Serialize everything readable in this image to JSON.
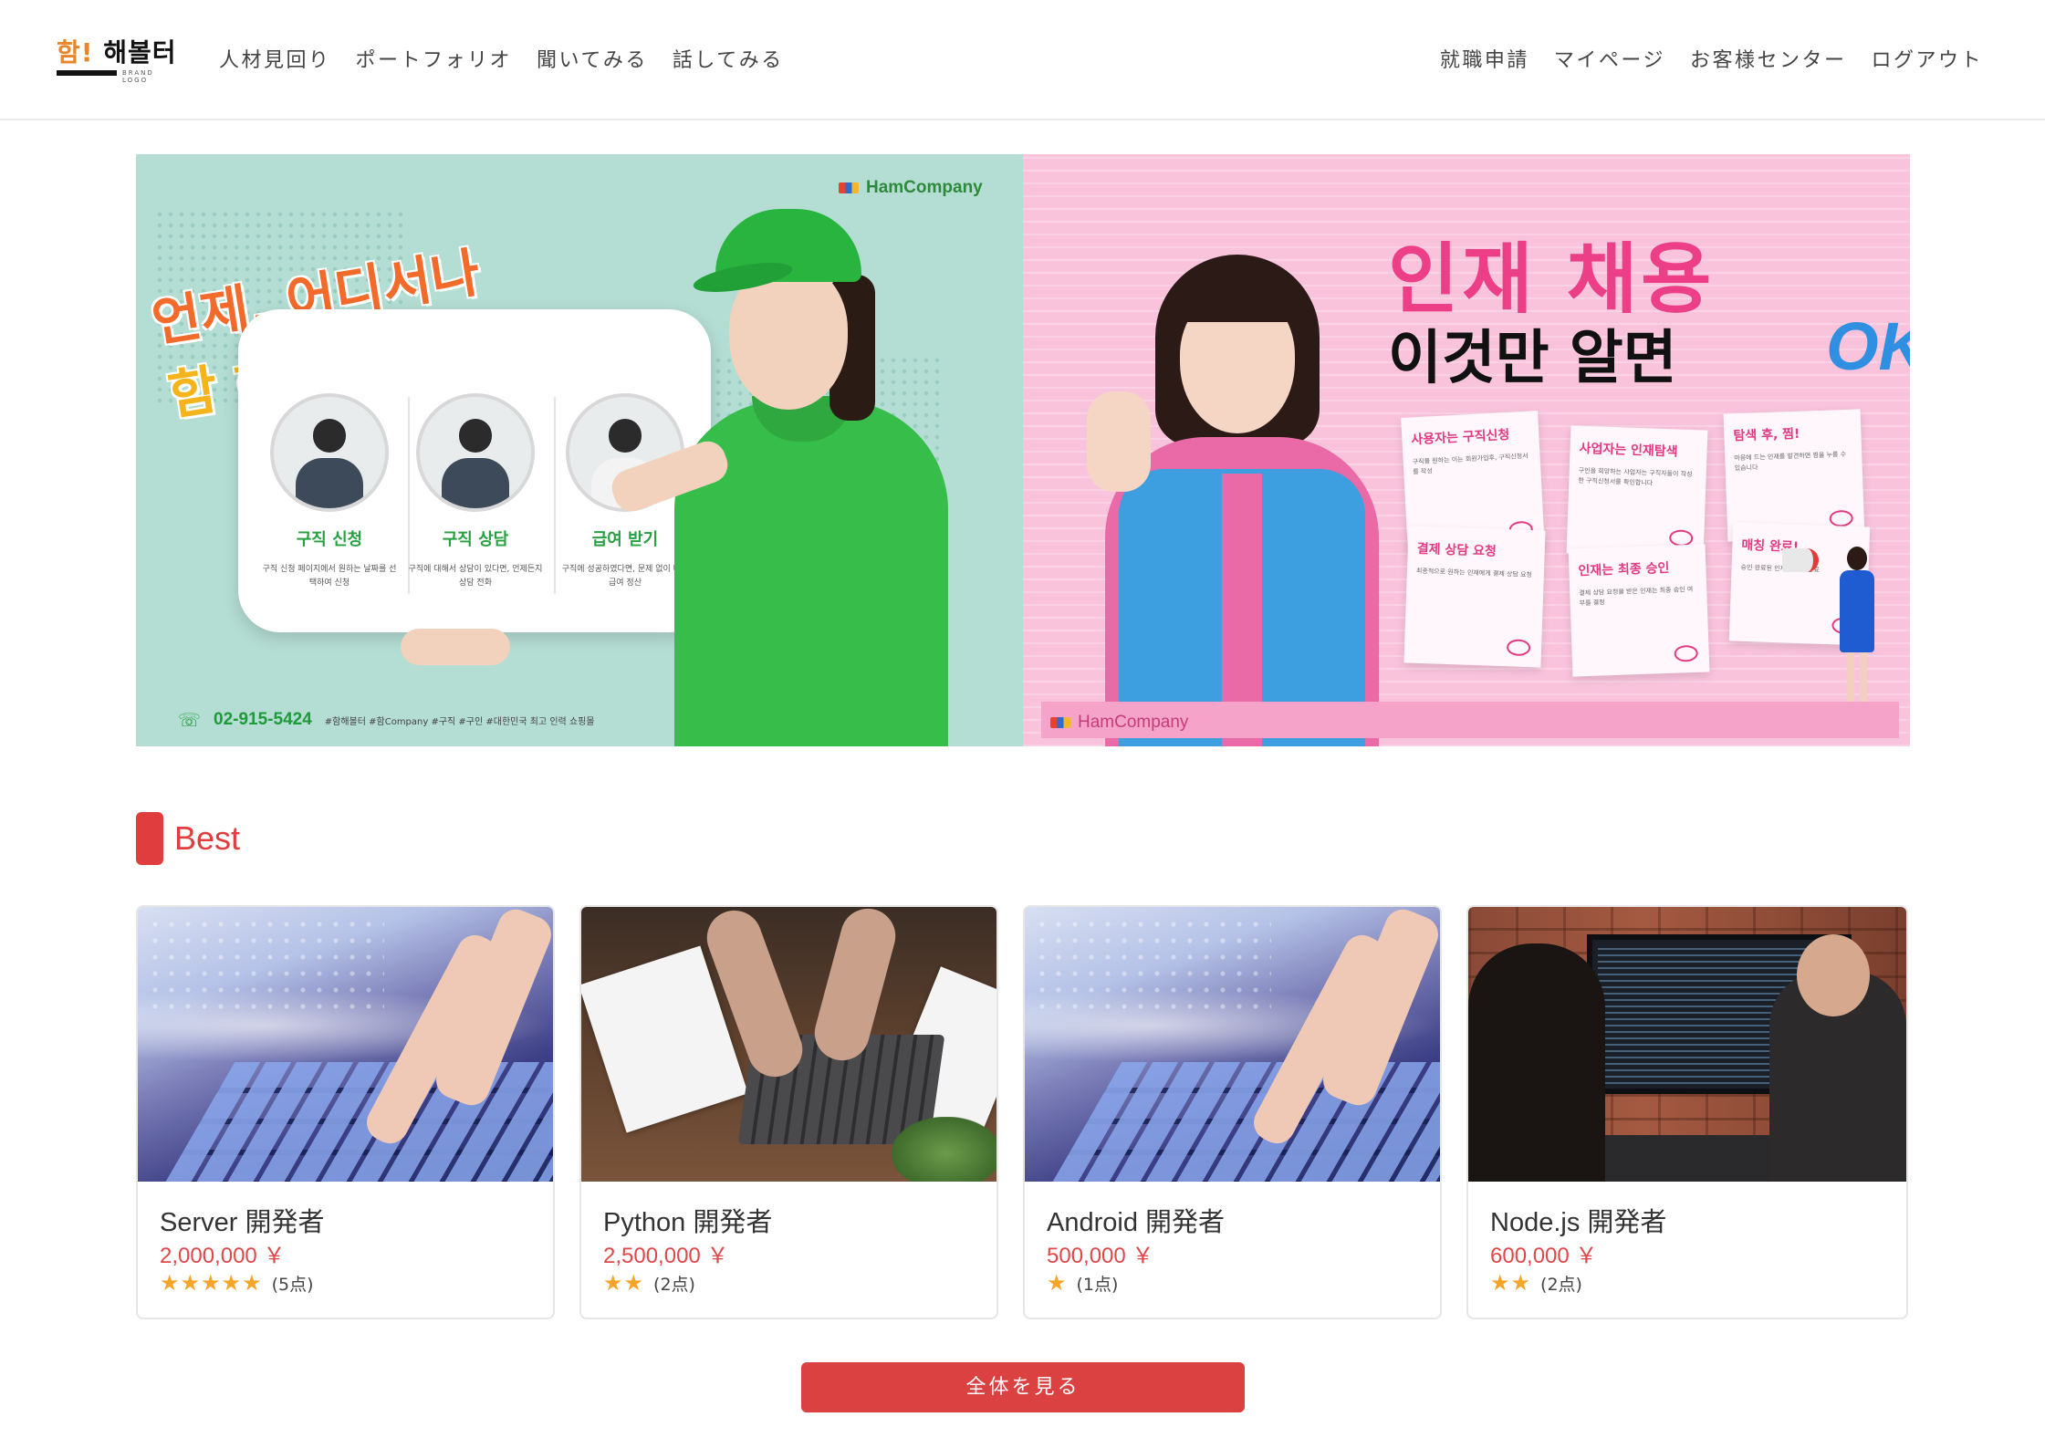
{
  "header": {
    "logo": {
      "accent": "함!",
      "word": "해볼터",
      "sub": "BRAND LOGO"
    },
    "nav_left": [
      "人材見回り",
      "ポートフォリオ",
      "聞いてみる",
      "話してみる"
    ],
    "nav_right": [
      "就職申請",
      "マイページ",
      "お客様センター",
      "ログアウト"
    ]
  },
  "banner": {
    "left": {
      "brand": "HamCompany",
      "headline_line1": "언제, 어디서나",
      "headline_line2": "함 해볼터!?",
      "steps": [
        {
          "title": "구직 신청",
          "desc": "구직 신청 페이지에서 원하는 날짜를 선택하여 신청"
        },
        {
          "title": "구직 상담",
          "desc": "구직에 대해서 상담이 있다면, 언제든지 상담 전화"
        },
        {
          "title": "급여 받기",
          "desc": "구직에 성공하였다면, 문제 없이 바로 급여 정산"
        }
      ],
      "phone": "02-915-5424",
      "hashtags": "#함해볼터 #함Company #구직 #구인 #대한민국 최고 인력 쇼핑몰"
    },
    "right": {
      "headline_line1": "인재 채용",
      "headline_line2": "이것만 알면",
      "headline_ok": "OK",
      "notes": [
        {
          "title": "사용자는 구직신청",
          "desc": "구직을 원하는 이는 회원가입후, 구직신청서를 작성"
        },
        {
          "title": "사업자는 인재탐색",
          "desc": "구인을 희망하는 사업자는 구직자들이 작성한 구직신청서를 확인합니다"
        },
        {
          "title": "탐색 후, 찜!",
          "desc": "마음에 드는 인재를 발견하면 찜을 누를 수 있습니다"
        },
        {
          "title": "결제 상담 요청",
          "desc": "최종적으로 원하는 인재에게 결제 상담 요청"
        },
        {
          "title": "인재는 최종 승인",
          "desc": "결제 상담 요청을 받은 인재는 최종 승인 여부를 결정"
        },
        {
          "title": "매칭 완료!",
          "desc": "승인 완료된 인재와 매칭 완료"
        }
      ],
      "brand": "HamCompany"
    }
  },
  "best": {
    "title": "Best",
    "cards": [
      {
        "title": "Server 開発者",
        "price": "2,000,000 ￥",
        "stars": "★★★★★",
        "count": "(5点)"
      },
      {
        "title": "Python 開発者",
        "price": "2,500,000 ￥",
        "stars": "★★",
        "count": "(2点)"
      },
      {
        "title": "Android 開発者",
        "price": "500,000 ￥",
        "stars": "★",
        "count": "(1点)"
      },
      {
        "title": "Node.js 開発者",
        "price": "600,000 ￥",
        "stars": "★★",
        "count": "(2点)"
      }
    ]
  },
  "cta": {
    "label": "全体を見る"
  },
  "colors": {
    "accent_red": "#e03e3e",
    "star": "#f4a52a",
    "price": "#e0484a"
  }
}
